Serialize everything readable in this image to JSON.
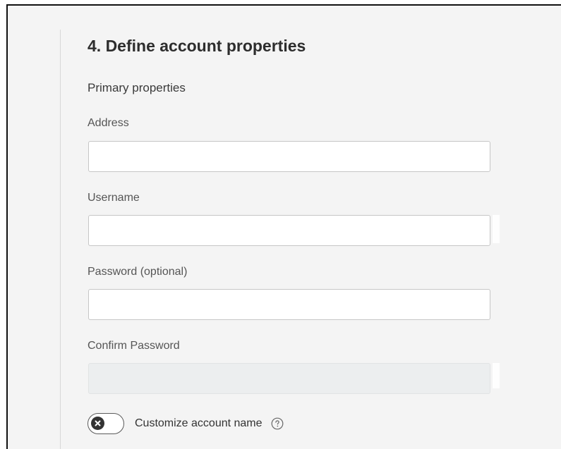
{
  "section": {
    "title": "4. Define account properties",
    "subtitle": "Primary properties"
  },
  "fields": {
    "address": {
      "label": "Address",
      "value": "",
      "placeholder": ""
    },
    "username": {
      "label": "Username",
      "value": "",
      "placeholder": ""
    },
    "password": {
      "label": "Password (optional)",
      "value": "",
      "placeholder": ""
    },
    "confirm_password": {
      "label": "Confirm Password",
      "value": "",
      "placeholder": "",
      "disabled": true
    }
  },
  "customize": {
    "label": "Customize account name",
    "enabled": false,
    "toggle_icon": "x-icon",
    "help_icon": "question-circle-icon"
  },
  "colors": {
    "background": "#f4f4f4",
    "toggle_knob": "#333333"
  }
}
